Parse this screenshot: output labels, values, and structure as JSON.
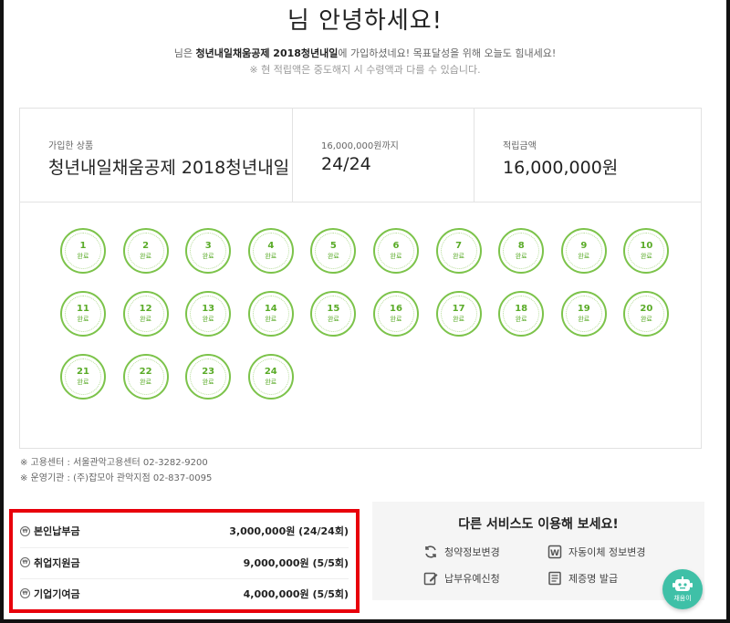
{
  "header": {
    "greeting": "님 안녕하세요!",
    "intro_prefix": "님은 ",
    "intro_product": "청년내일채움공제 2018청년내일",
    "intro_suffix": "에 가입하셨네요! 목표달성을 위해 오늘도 힘내세요!",
    "notice": "※ 현 적립액은 중도해지 시 수령액과 다를 수 있습니다."
  },
  "summary": {
    "product_label": "가입한 상품",
    "product_value": "청년내일채움공제 2018청년내일",
    "count_label": "16,000,000원까지",
    "count_value": "24/24",
    "total_label": "적립금액",
    "total_value": "16,000,000원"
  },
  "installments": {
    "status_label": "완료",
    "items": [
      "1",
      "2",
      "3",
      "4",
      "5",
      "6",
      "7",
      "8",
      "9",
      "10",
      "11",
      "12",
      "13",
      "14",
      "15",
      "16",
      "17",
      "18",
      "19",
      "20",
      "21",
      "22",
      "23",
      "24"
    ],
    "accent_color": "#7cc34a"
  },
  "contacts": {
    "employment_center": "※ 고용센터 : 서울관악고용센터 02-3282-9200",
    "operator": "※ 운영기관 : (주)잡모아 관악지점 02-837-0095"
  },
  "payments": [
    {
      "icon": "won-icon",
      "label": "본인납부금",
      "value": "3,000,000원 (24/24회)"
    },
    {
      "icon": "won-icon",
      "label": "취업지원금",
      "value": "9,000,000원 (5/5회)"
    },
    {
      "icon": "won-icon",
      "label": "기업기여금",
      "value": "4,000,000원 (5/5회)"
    }
  ],
  "highlight_color": "#e8000b",
  "services": {
    "title": "다른 서비스도 이용해 보세요!",
    "links": [
      {
        "icon": "refresh-icon",
        "label": "청약정보변경"
      },
      {
        "icon": "won-square-icon",
        "label": "자동이체 정보변경"
      },
      {
        "icon": "edit-icon",
        "label": "납부유예신청"
      },
      {
        "icon": "document-icon",
        "label": "제증명 발급"
      }
    ]
  },
  "chat": {
    "icon": "chatbot-icon",
    "label": "채움이",
    "color": "#3fc0a7"
  }
}
